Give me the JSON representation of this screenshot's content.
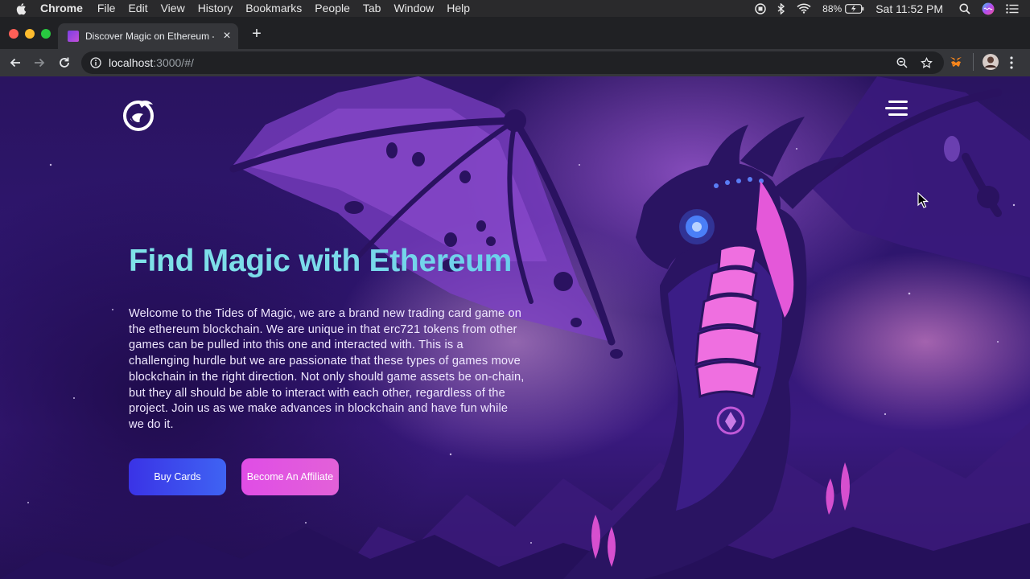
{
  "menubar": {
    "app_name": "Chrome",
    "items": [
      "File",
      "Edit",
      "View",
      "History",
      "Bookmarks",
      "People",
      "Tab",
      "Window",
      "Help"
    ],
    "battery": "88%",
    "clock": "Sat 11:52 PM"
  },
  "browser": {
    "tab_title": "Discover Magic on Ethereum -",
    "url_host": "localhost",
    "url_path": ":3000/#/"
  },
  "hero": {
    "title": "Find Magic with Ethereum",
    "description": "Welcome to the Tides of Magic, we are a brand new trading card game on the ethereum blockchain. We are unique in that erc721 tokens from other games can be pulled into this one and interacted with. This is a challenging hurdle but we are passionate that these types of games move blockchain in the right direction. Not only should game assets be on-chain, but they all should be able to interact with each other, regardless of the project. Join us as we make advances in blockchain and have fun while we do it.",
    "buy_button": "Buy Cards",
    "affiliate_button": "Become An Affiliate"
  },
  "colors": {
    "title_gradient_start": "#7fe3e8",
    "buy_button": "#3a33e6",
    "affiliate_button": "#e04de6",
    "background": "#2a1460"
  }
}
